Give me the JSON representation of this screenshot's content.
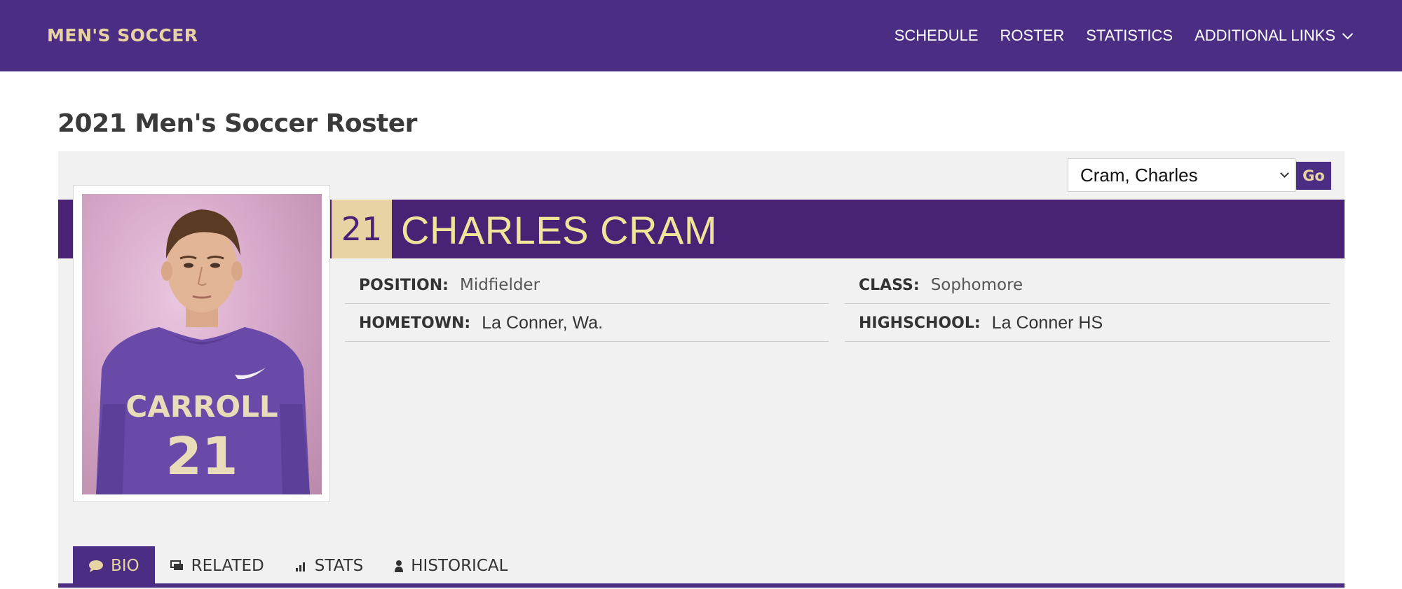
{
  "header": {
    "brand": "MEN'S SOCCER",
    "nav": [
      {
        "label": "SCHEDULE"
      },
      {
        "label": "ROSTER"
      },
      {
        "label": "STATISTICS"
      },
      {
        "label": "ADDITIONAL LINKS"
      }
    ]
  },
  "page": {
    "title": "2021 Men's Soccer Roster"
  },
  "player_select": {
    "selected": "Cram, Charles",
    "go_label": "Go"
  },
  "player": {
    "number": "21",
    "name": "CHARLES CRAM",
    "jersey_text": "CARROLL",
    "jersey_number": "21",
    "details": [
      {
        "label": "POSITION:",
        "value": "Midfielder"
      },
      {
        "label": "CLASS:",
        "value": "Sophomore"
      },
      {
        "label": "HOMETOWN:",
        "value": "La Conner, Wa."
      },
      {
        "label": "HIGHSCHOOL:",
        "value": "La Conner HS"
      }
    ]
  },
  "tabs": [
    {
      "label": "BIO",
      "icon": "speech-bubble-icon",
      "active": true
    },
    {
      "label": "RELATED",
      "icon": "related-icon",
      "active": false
    },
    {
      "label": "STATS",
      "icon": "bar-chart-icon",
      "active": false
    },
    {
      "label": "HISTORICAL",
      "icon": "person-icon",
      "active": false
    }
  ],
  "colors": {
    "primary_purple": "#4b2e83",
    "banner_purple": "#4a2275",
    "gold": "#e8d3a2",
    "name_yellow": "#f2e39a"
  }
}
